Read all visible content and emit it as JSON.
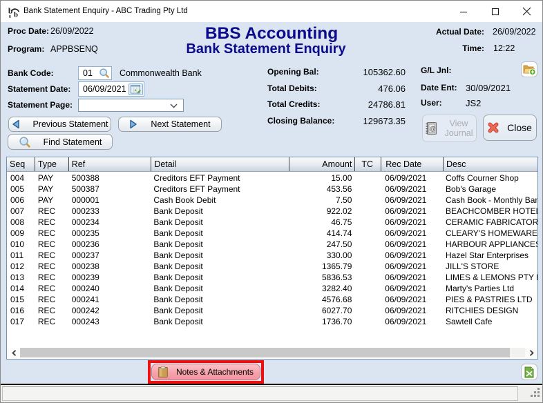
{
  "window": {
    "title": "Bank Statement Enquiry - ABC Trading Pty Ltd"
  },
  "header": {
    "proc_date_label": "Proc Date:",
    "proc_date": "26/09/2022",
    "program_label": "Program:",
    "program": "APPBSENQ",
    "app_title": "BBS Accounting",
    "screen_title": "Bank Statement Enquiry",
    "actual_date_label": "Actual Date:",
    "actual_date": "26/09/2022",
    "time_label": "Time:",
    "time": "12:22"
  },
  "form": {
    "bank_code_label": "Bank Code:",
    "bank_code": "01",
    "bank_name": "Commonwealth Bank",
    "statement_date_label": "Statement Date:",
    "statement_date": "06/09/2021",
    "statement_page_label": "Statement Page:",
    "statement_page": "",
    "prev_button": "Previous Statement",
    "next_button": "Next Statement",
    "find_button": "Find Statement"
  },
  "summary": {
    "opening_bal_label": "Opening Bal:",
    "opening_bal": "105362.60",
    "total_debits_label": "Total Debits:",
    "total_debits": "476.06",
    "total_credits_label": "Total Credits:",
    "total_credits": "24786.81",
    "closing_balance_label": "Closing Balance:",
    "closing_balance": "129673.35"
  },
  "journal": {
    "gl_jnl_label": "G/L Jnl:",
    "date_ent_label": "Date Ent:",
    "date_ent": "30/09/2021",
    "user_label": "User:",
    "user": "JS2",
    "view_journal_button": "View Journal",
    "close_button": "Close"
  },
  "table": {
    "columns": [
      "Seq",
      "Type",
      "Ref",
      "Detail",
      "Amount",
      "TC",
      "Rec Date",
      "Desc"
    ],
    "column_keys": [
      "seq",
      "type",
      "ref",
      "detail",
      "amount",
      "tc",
      "rec-date",
      "desc"
    ],
    "rows": [
      [
        "004",
        "PAY",
        "500388",
        "Creditors EFT Payment",
        "15.00",
        "",
        "06/09/2021",
        "Coffs Courner Shop"
      ],
      [
        "005",
        "PAY",
        "500387",
        "Creditors EFT Payment",
        "453.56",
        "",
        "06/09/2021",
        "Bob's Garage"
      ],
      [
        "006",
        "PAY",
        "000001",
        "Cash Book Debit",
        "7.50",
        "",
        "06/09/2021",
        "Cash Book - Monthly Bank"
      ],
      [
        "007",
        "REC",
        "000233",
        "Bank Deposit",
        "922.02",
        "",
        "06/09/2021",
        "BEACHCOMBER HOTEL"
      ],
      [
        "008",
        "REC",
        "000234",
        "Bank Deposit",
        "46.75",
        "",
        "06/09/2021",
        "CERAMIC FABRICATORS"
      ],
      [
        "009",
        "REC",
        "000235",
        "Bank Deposit",
        "414.74",
        "",
        "06/09/2021",
        "CLEARY'S HOMEWARES"
      ],
      [
        "010",
        "REC",
        "000236",
        "Bank Deposit",
        "247.50",
        "",
        "06/09/2021",
        "HARBOUR APPLIANCES"
      ],
      [
        "011",
        "REC",
        "000237",
        "Bank Deposit",
        "330.00",
        "",
        "06/09/2021",
        "Hazel Star Enterprises"
      ],
      [
        "012",
        "REC",
        "000238",
        "Bank Deposit",
        "1365.79",
        "",
        "06/09/2021",
        "JILL'S STORE"
      ],
      [
        "013",
        "REC",
        "000239",
        "Bank Deposit",
        "5836.53",
        "",
        "06/09/2021",
        "LIMES & LEMONS PTY LTD"
      ],
      [
        "014",
        "REC",
        "000240",
        "Bank Deposit",
        "3282.40",
        "",
        "06/09/2021",
        "Marty's Parties Ltd"
      ],
      [
        "015",
        "REC",
        "000241",
        "Bank Deposit",
        "4576.68",
        "",
        "06/09/2021",
        "PIES & PASTRIES LTD"
      ],
      [
        "016",
        "REC",
        "000242",
        "Bank Deposit",
        "6027.70",
        "",
        "06/09/2021",
        "RITCHIES DESIGN"
      ],
      [
        "017",
        "REC",
        "000243",
        "Bank Deposit",
        "1736.70",
        "",
        "06/09/2021",
        "Sawtell Cafe"
      ]
    ]
  },
  "footer": {
    "notes_button": "Notes & Attachments"
  },
  "colors": {
    "panel_bg": "#dbe5f1",
    "heading_navy": "#0b0b8b",
    "annotation_red": "#ec1111",
    "notes_pink": "#f6a2ab"
  },
  "icons": {
    "app": "bbs-logo",
    "bank_code_lookup": "magnifier-icon",
    "statement_date_picker": "calendar-icon",
    "previous": "arrow-left-icon",
    "next": "arrow-right-icon",
    "find": "magnifier-icon",
    "gl_jnl": "folder-add-icon",
    "view_journal": "journal-book-icon",
    "close": "red-x-icon",
    "notes": "clipboard-icon",
    "export": "excel-icon"
  }
}
